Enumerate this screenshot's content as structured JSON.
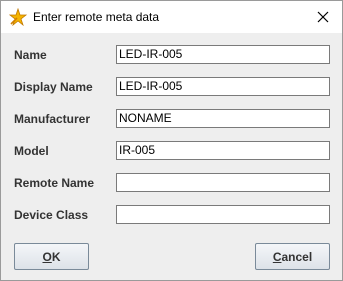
{
  "window": {
    "title": "Enter remote meta data",
    "icon": "star-wand-icon"
  },
  "fields": [
    {
      "label": "Name",
      "value": "LED-IR-005"
    },
    {
      "label": "Display Name",
      "value": "LED-IR-005"
    },
    {
      "label": "Manufacturer",
      "value": "NONAME"
    },
    {
      "label": "Model",
      "value": "IR-005"
    },
    {
      "label": "Remote Name",
      "value": ""
    },
    {
      "label": "Device Class",
      "value": ""
    }
  ],
  "buttons": {
    "ok": {
      "mnemonic": "O",
      "rest": "K"
    },
    "cancel": {
      "mnemonic": "C",
      "rest": "ancel"
    }
  },
  "colors": {
    "dialog_bg": "#eeeeee",
    "label_text": "#333333",
    "icon_gold": "#f0a000"
  }
}
